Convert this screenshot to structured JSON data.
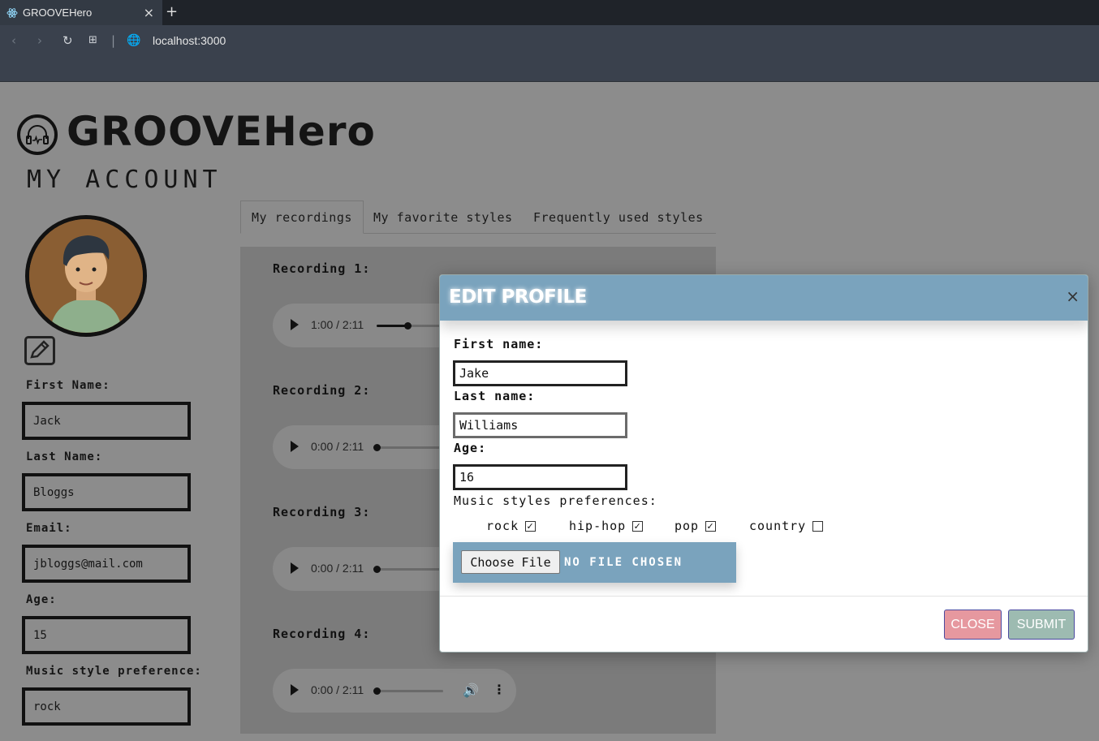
{
  "browser": {
    "tab_title": "GROOVEHero",
    "tab_close": "×",
    "new_tab": "+",
    "url": "localhost:3000"
  },
  "header": {
    "brand": "GROOVEHero",
    "page_title": "MY ACCOUNT"
  },
  "profile": {
    "fields": [
      {
        "label": "First Name:",
        "value": "Jack"
      },
      {
        "label": "Last Name:",
        "value": "Bloggs"
      },
      {
        "label": "Email:",
        "value": "jbloggs@mail.com"
      },
      {
        "label": "Age:",
        "value": "15"
      },
      {
        "label": "Music style preference:",
        "value": "rock"
      }
    ]
  },
  "tabs": [
    {
      "label": "My recordings",
      "active": true
    },
    {
      "label": "My favorite styles",
      "active": false
    },
    {
      "label": "Frequently used styles",
      "active": false
    }
  ],
  "recordings": [
    {
      "label": "Recording 1:",
      "time": "1:00 / 2:11",
      "progress": 0.46
    },
    {
      "label": "Recording 2:",
      "time": "0:00 / 2:11",
      "progress": 0
    },
    {
      "label": "Recording 3:",
      "time": "0:00 / 2:11",
      "progress": 0
    },
    {
      "label": "Recording 4:",
      "time": "0:00 / 2:11",
      "progress": 0
    }
  ],
  "modal": {
    "title": "EDIT PROFILE",
    "close_x": "×",
    "first_name_label": "First name:",
    "first_name_value": "Jake",
    "last_name_label": "Last name:",
    "last_name_value": "Williams",
    "age_label": "Age:",
    "age_value": "16",
    "prefs_label": "Music styles preferences:",
    "styles": [
      {
        "label": "rock",
        "checked": true
      },
      {
        "label": "hip-hop",
        "checked": true
      },
      {
        "label": "pop",
        "checked": true
      },
      {
        "label": "country",
        "checked": false
      }
    ],
    "choose_file": "Choose File",
    "file_status": "NO FILE CHOSEN",
    "close_button": "CLOSE",
    "submit_button": "SUBMIT"
  },
  "colors": {
    "modal_header": "#7aa3bd",
    "close_button": "#e6989f",
    "submit_button": "#9dbbb1",
    "overlay_page": "#8c8c8c"
  }
}
